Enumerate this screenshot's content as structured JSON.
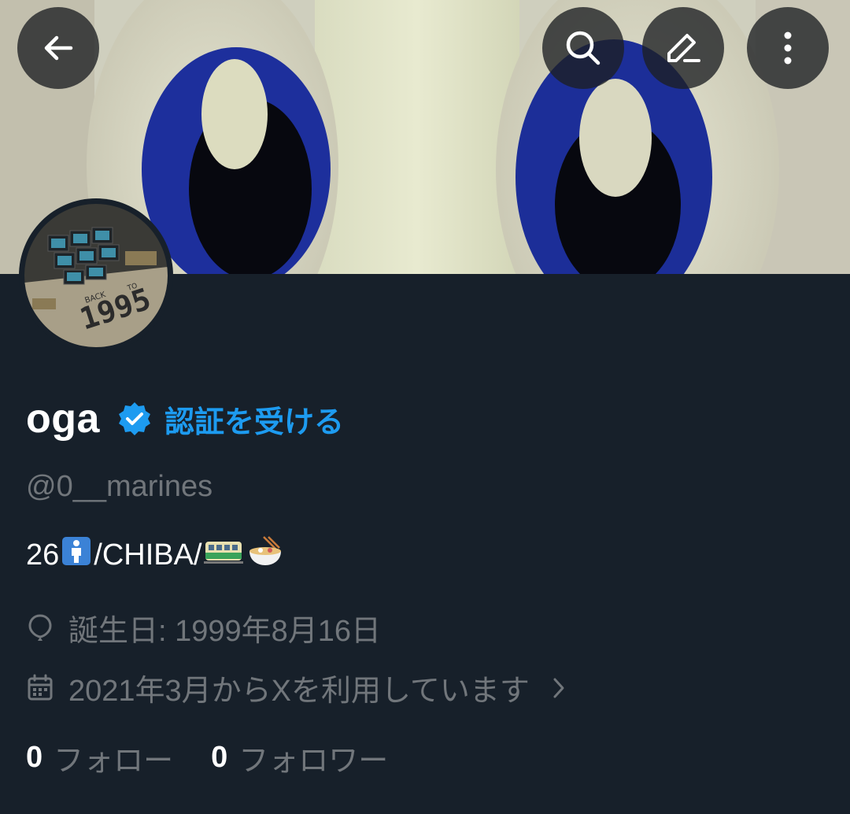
{
  "header": {
    "back_icon": "arrow-left-icon",
    "search_icon": "search-icon",
    "edit_icon": "pencil-icon",
    "more_icon": "vertical-ellipsis-icon"
  },
  "profile": {
    "display_name": "oga",
    "verified_badge_icon": "verified-badge-icon",
    "get_verified_label": "認証を受ける",
    "handle": "@0__marines",
    "bio": {
      "age": "26",
      "man_emoji": "🚹",
      "location": "/CHIBA/",
      "train_emoji": "🚃",
      "ramen_emoji": "🍜"
    },
    "birthday": "誕生日: 1999年8月16日",
    "joined": "2021年3月からXを利用しています",
    "following_count": "0",
    "following_label": "フォロー",
    "followers_count": "0",
    "followers_label": "フォロワー"
  },
  "avatar": {
    "text_back": "BACK",
    "text_to": "TO",
    "text_year": "1995"
  },
  "colors": {
    "background": "#17202a",
    "accent": "#1d9bf0",
    "muted_text": "#71767b",
    "primary_text": "#ffffff"
  }
}
